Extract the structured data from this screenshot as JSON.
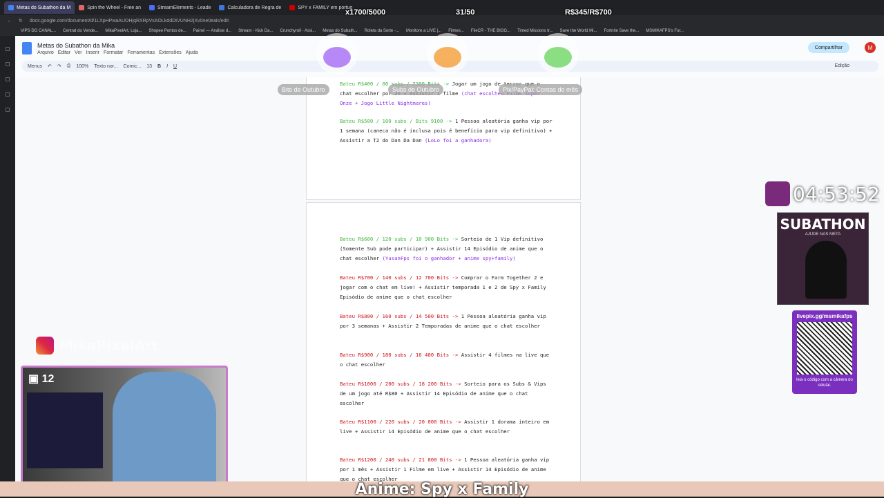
{
  "browser": {
    "tabs": [
      {
        "label": "Metas do Subathon da M",
        "color": "#4285f4",
        "active": true
      },
      {
        "label": "Spin the Wheel - Free an",
        "color": "#e06666",
        "active": false
      },
      {
        "label": "StreamElements - Leade",
        "color": "#4a6cf7",
        "active": false
      },
      {
        "label": "Calculadora de Regra de",
        "color": "#3c78d8",
        "active": false
      },
      {
        "label": "SPY x FAMILY em portug",
        "color": "#cc0000",
        "active": false
      }
    ],
    "url": "docs.google.com/document/d/1LXpHPwaAUOHjqRXRpVsAOLkddDtVUNH2jXv0ne0eais/edit",
    "bookmarks": [
      "VIPS DO CANAL...",
      "Central do Vende...",
      "MikaPixelArt, Loja...",
      "Shopee Pontos de...",
      "Painel — Análise d...",
      "Stream - Kick Da...",
      "Crunchyroll - Assi...",
      "Metas do Subath...",
      "Roleta da Sorte -...",
      "Monitore a LIVE |...",
      "Filmes...",
      "FileCR - THE BIGG...",
      "Timed Missions tr...",
      "Save the World Mi...",
      "Fortnite Save the...",
      "MSMIKAFPS's For..."
    ]
  },
  "doc": {
    "title": "Metas do Subathon da Mika",
    "menus": [
      "Arquivo",
      "Editar",
      "Ver",
      "Inserir",
      "Formatar",
      "Ferramentas",
      "Extensões",
      "Ajuda"
    ],
    "toolbar": {
      "search": "Menus",
      "zoom": "100%",
      "style": "Texto nor...",
      "font": "Comic...",
      "size": "13",
      "mode": "Edição"
    },
    "share_label": "Compartilhar",
    "avatar_letter": "M"
  },
  "goals_page1": [
    {
      "head": "Bateu R$400 / 80 subs / 7300 Bits ->",
      "head_color": "green",
      "text": " Jogar um jogo de terror que o chat escolher por 2h + Assistir 1 filme ",
      "note": "(chat escolheu Filme Super Onze + Jogo Little Nightmares)"
    },
    {
      "head": "Bateu R$500 / 100 subs / Bits 9100 ->",
      "head_color": "green",
      "text": " 1 Pessoa aleatória ganha vip por 1 semana (caneca não é inclusa pois é benefício para vip definitivo) + Assistir a T2 do Dan Da Dan ",
      "note": "(LoLo foi a ganhadora)"
    }
  ],
  "goals_page2": [
    {
      "head": "Bateu R$600 / 120 subs / 10 900 Bits ->",
      "head_color": "green",
      "text": " Sorteio de 1 Vip definitivo (Somente Sub pode participar) + Assistir 14 Episódio de anime que o chat escolher ",
      "note": "(YusanFps foi o ganhador + anime spy+family)"
    },
    {
      "head": "Bateu R$700 / 140 subs / 12 700 Bits ->",
      "head_color": "red",
      "text": " Comprar o Farm Together 2 e jogar com o chat em live! + Assistir temporada 1 e 2 de Spy x Family Episódio de anime que o chat escolher",
      "note": ""
    },
    {
      "head": "Bateu R$800 / 160 subs / 14 500 Bits ->",
      "head_color": "red",
      "text": " 1 Pessoa aleatória ganha vip por 3 semanas + Assistir 2 Temporadas de anime que o chat escolher",
      "note": ""
    },
    {
      "head": "Bateu R$900 / 180 subs / 16 400 Bits ->",
      "head_color": "red",
      "text": " Assistir 4 filmes na live que o chat escolher",
      "note": ""
    },
    {
      "head": "Bateu R$1000 / 200 subs / 18 200 Bits ->",
      "head_color": "red",
      "text": " Sorteio para os Subs & Vips de um jogo até R$80 + Assistir 14 Episódio de anime que o chat escolher",
      "note": ""
    },
    {
      "head": "Bateu R$1100 / 220 subs / 20 000 Bits ->",
      "head_color": "red",
      "text": " Assistir 1 dorama inteiro em live + Assistir 14 Episódio de anime que o chat escolher",
      "note": ""
    },
    {
      "head": "Bateu R$1200 / 240 subs / 21 800 Bits ->",
      "head_color": "red",
      "text": " 1 Pessoa aleatória ganha vip por 1 mês + Assistir 1 Filme em live + Assistir 14 Episódio de anime que o chat escolher",
      "note": ""
    }
  ],
  "overlay": {
    "counters": [
      {
        "value": "x1700/5000",
        "label": "Bits de Outubro",
        "color": "#8a3df0",
        "progress": 0.34
      },
      {
        "value": "31/50",
        "label": "Subs de Outubro",
        "color": "#f39a2e",
        "progress": 0.62
      },
      {
        "value": "R$345/R$700",
        "label": "Pix/PayPal: Contas do mês",
        "color": "#59d14b",
        "progress": 0.49
      }
    ],
    "timer": "04:53:52",
    "subathon_title": "SUBATHON",
    "subathon_sub": "AJUDE NAS META",
    "qr_top": "livepix.gg/msmikafps",
    "qr_bottom": "leia o código com a câmera do celular.",
    "instagram": "MikaPixelArt",
    "viewers": "12",
    "caption": "Anime: Spy x Family"
  }
}
